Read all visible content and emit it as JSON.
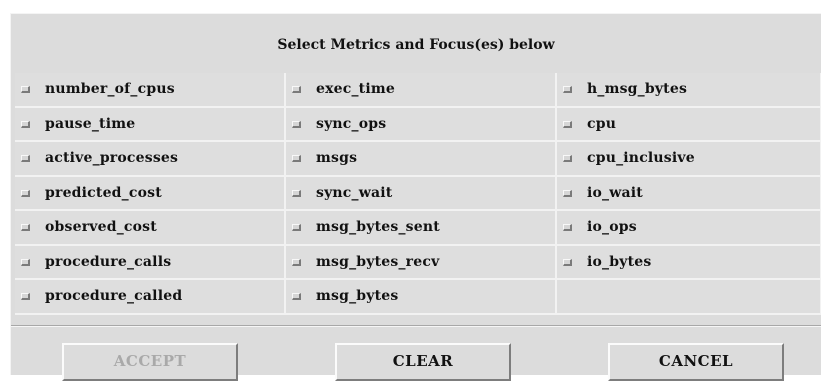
{
  "dialog": {
    "title": "Select Metrics and Focus(es) below"
  },
  "metrics": {
    "col1": [
      "number_of_cpus",
      "pause_time",
      "active_processes",
      "predicted_cost",
      "observed_cost",
      "procedure_calls",
      "procedure_called"
    ],
    "col2": [
      "exec_time",
      "sync_ops",
      "msgs",
      "sync_wait",
      "msg_bytes_sent",
      "msg_bytes_recv",
      "msg_bytes"
    ],
    "col3": [
      "h_msg_bytes",
      "cpu",
      "cpu_inclusive",
      "io_wait",
      "io_ops",
      "io_bytes"
    ]
  },
  "buttons": {
    "accept": "ACCEPT",
    "clear": "CLEAR",
    "cancel": "CANCEL",
    "accept_disabled": true
  }
}
